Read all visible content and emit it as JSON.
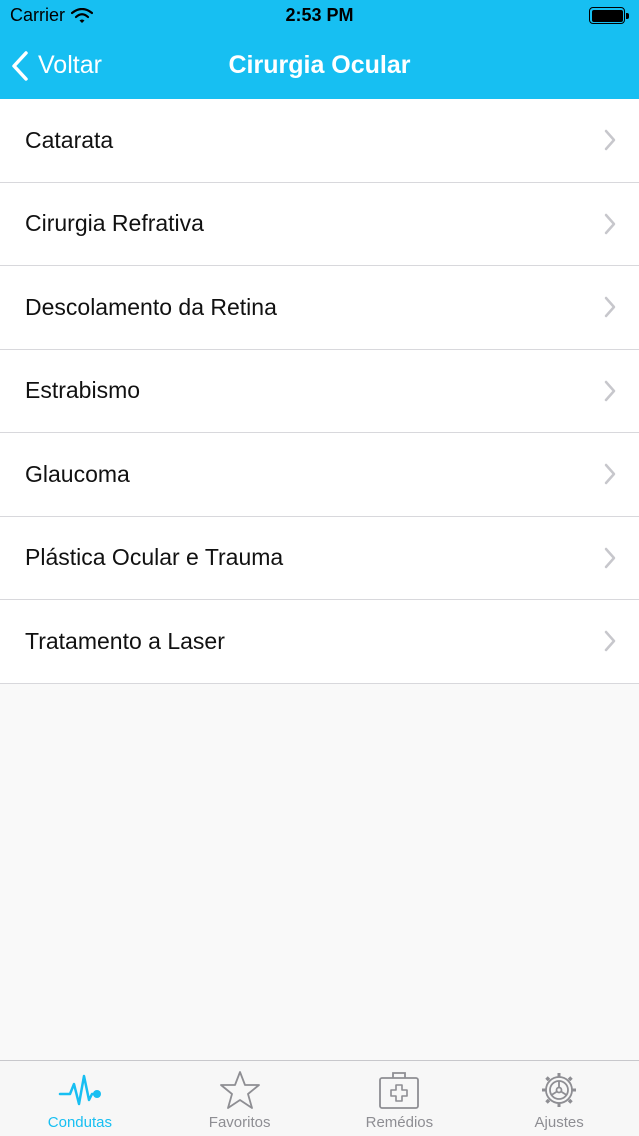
{
  "status_bar": {
    "carrier": "Carrier",
    "time": "2:53 PM"
  },
  "nav": {
    "back_label": "Voltar",
    "title": "Cirurgia Ocular"
  },
  "list": {
    "items": [
      {
        "label": "Catarata"
      },
      {
        "label": "Cirurgia Refrativa"
      },
      {
        "label": "Descolamento da Retina"
      },
      {
        "label": "Estrabismo"
      },
      {
        "label": "Glaucoma"
      },
      {
        "label": "Plástica Ocular e Trauma"
      },
      {
        "label": "Tratamento a Laser"
      }
    ]
  },
  "tabbar": {
    "tabs": [
      {
        "label": "Condutas",
        "icon": "heartbeat-icon",
        "active": true
      },
      {
        "label": "Favoritos",
        "icon": "star-icon",
        "active": false
      },
      {
        "label": "Remédios",
        "icon": "medical-kit-icon",
        "active": false
      },
      {
        "label": "Ajustes",
        "icon": "gear-icon",
        "active": false
      }
    ]
  },
  "colors": {
    "accent": "#17bff2",
    "tab_inactive": "#8e8e93",
    "separator": "#d8d8dc"
  }
}
